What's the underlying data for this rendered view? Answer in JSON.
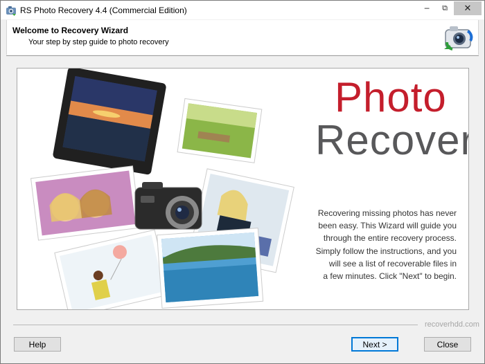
{
  "window": {
    "title": "RS Photo Recovery 4.4 (Commercial Edition)",
    "controls": [
      "min-icon",
      "max-icon",
      "close-icon"
    ]
  },
  "header": {
    "title": "Welcome to Recovery Wizard",
    "subtitle": "Your step by step guide to photo recovery"
  },
  "brand": {
    "line1": "Photo",
    "line2": "Recovery",
    "color_primary": "#c41e2c",
    "color_secondary": "#58585a"
  },
  "description": [
    "Recovering missing photos has never",
    "been easy. This Wizard will guide you",
    "through the entire recovery process.",
    "Simply follow the instructions, and you",
    "will see a list of recoverable files in",
    "a few minutes. Click \"Next\" to begin."
  ],
  "footer": {
    "site": "recoverhdd.com"
  },
  "buttons": {
    "help": "Help",
    "next": "Next >",
    "close": "Close"
  },
  "colors": {
    "accent": "#0078d7"
  }
}
